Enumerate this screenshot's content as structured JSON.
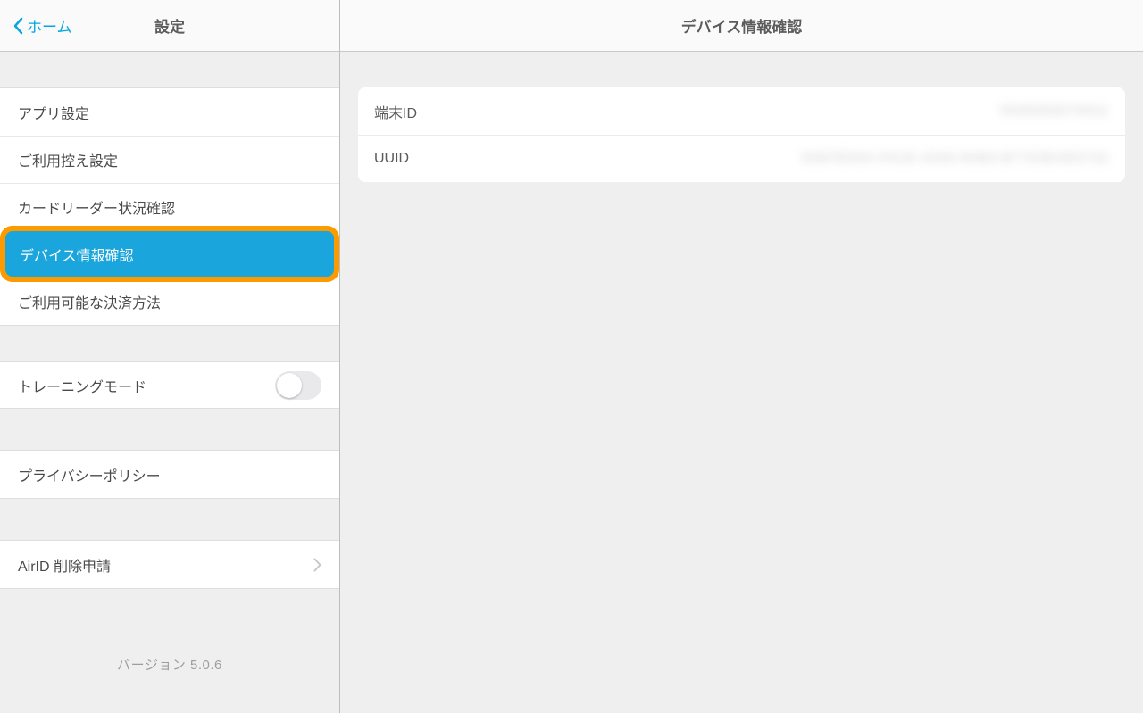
{
  "sidebar": {
    "back_label": "ホーム",
    "title": "設定",
    "items": {
      "app_settings": "アプリ設定",
      "receipt_settings": "ご利用控え設定",
      "card_reader_status": "カードリーダー状況確認",
      "device_info": "デバイス情報確認",
      "payment_methods": "ご利用可能な決済方法"
    },
    "training_mode_label": "トレーニングモード",
    "privacy_policy": "プライバシーポリシー",
    "airid_delete": "AirID 削除申請",
    "version_label": "バージョン 5.0.6"
  },
  "main": {
    "title": "デバイス情報確認",
    "rows": {
      "terminal_id": {
        "label": "端末ID",
        "value": "5508369074031"
      },
      "uuid": {
        "label": "UUID",
        "value": "D587E55A-FA1E-4340-9AB3-B7703EAE5732"
      }
    }
  }
}
